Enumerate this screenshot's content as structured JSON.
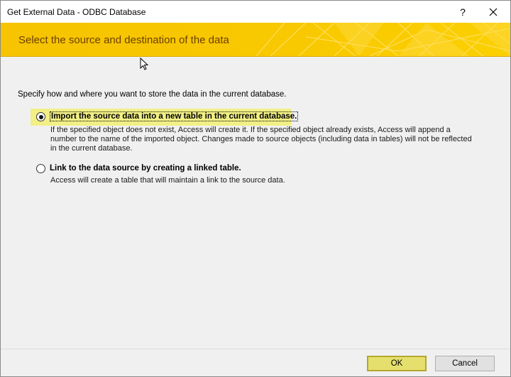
{
  "window": {
    "title": "Get External Data - ODBC Database",
    "help_label": "?"
  },
  "banner": {
    "title": "Select the source and destination of the data",
    "color": "#f6c400"
  },
  "content": {
    "instruction": "Specify how and where you want to store the data in the current database.",
    "options": [
      {
        "label": "Import the source data into a new table in the current database.",
        "description": "If the specified object does not exist, Access will create it. If the specified object already exists, Access will append a number to the name of the imported object. Changes made to source objects (including data in tables) will not be reflected in the current database.",
        "selected": true
      },
      {
        "label": "Link to the data source by creating a linked table.",
        "description": "Access will create a table that will maintain a link to the source data.",
        "selected": false
      }
    ]
  },
  "buttons": {
    "ok_label": "OK",
    "cancel_label": "Cancel"
  },
  "icons": {
    "close": "close-icon",
    "help": "help-icon",
    "cursor": "mouse-pointer-icon"
  }
}
